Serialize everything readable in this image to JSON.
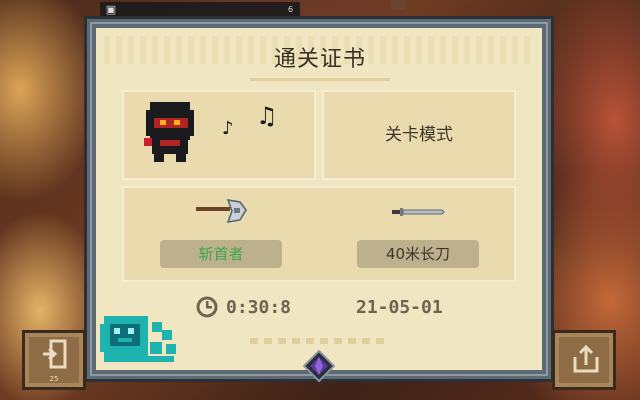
{
  "certificate": {
    "title": "通关证书",
    "mode": "关卡模式",
    "weapons": [
      {
        "name": "斩首者",
        "color": "#3fa84a",
        "icon": "axe-icon"
      },
      {
        "name": "40米长刀",
        "color": "#3e352a",
        "icon": "long-blade-icon"
      }
    ],
    "time": "0:30:8",
    "date": "21-05-01"
  },
  "top_bar": {
    "page_number": "6"
  },
  "buttons": {
    "exit_sub": "25"
  },
  "icons": {
    "hero": "ninja-hero-icon",
    "music": "music-notes-icon",
    "clock": "clock-icon",
    "gem": "purple-gem-icon",
    "exit": "exit-door-icon",
    "share": "share-icon",
    "badge": "teal-badge-icon",
    "controller": "controller-icon"
  },
  "colors": {
    "paper": "#f1e6c2",
    "card": "#e9dbad",
    "pill": "#bcb08d",
    "frame": "#5d6a74",
    "weapon_highlight": "#3fa84a",
    "badge": "#1fb3b0"
  }
}
